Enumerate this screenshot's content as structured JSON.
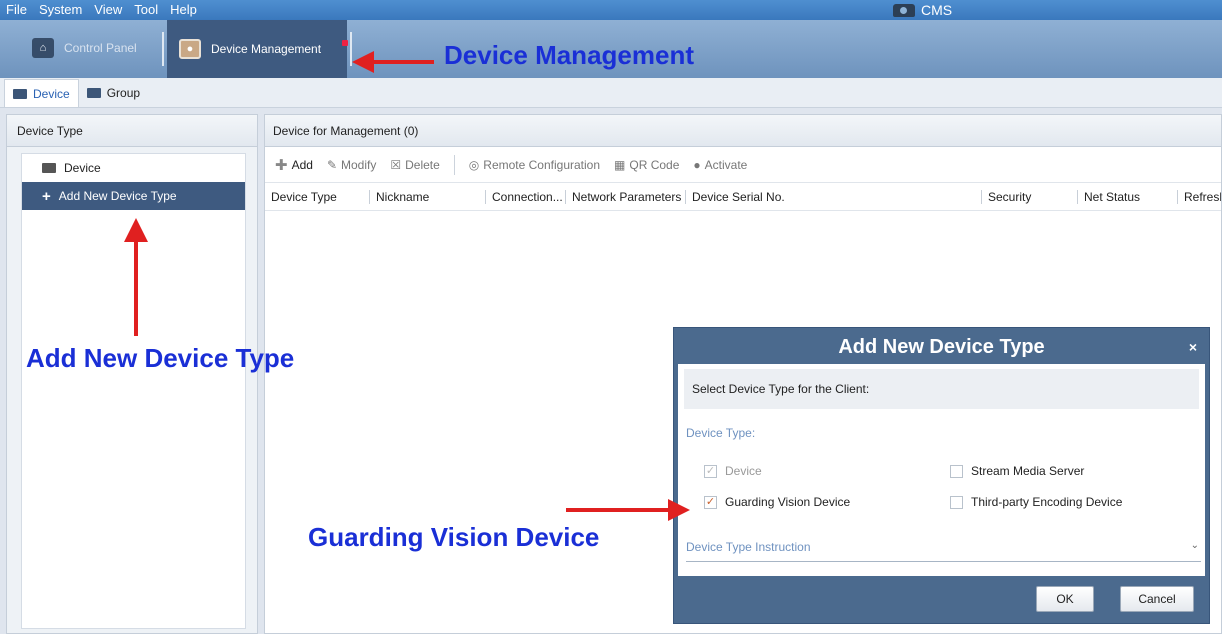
{
  "menubar": {
    "items": [
      "File",
      "System",
      "View",
      "Tool",
      "Help"
    ],
    "app_title": "CMS"
  },
  "module_tabs": {
    "control_panel": "Control Panel",
    "device_management": "Device Management"
  },
  "sub_tabs": {
    "device": "Device",
    "group": "Group"
  },
  "left_panel": {
    "title": "Device Type",
    "items": [
      "Device",
      "Add New Device Type"
    ]
  },
  "main_panel": {
    "title": "Device for Management (0)",
    "toolbar": {
      "add": "Add",
      "modify": "Modify",
      "delete": "Delete",
      "remote_config": "Remote Configuration",
      "qr_code": "QR Code",
      "activate": "Activate"
    },
    "columns": [
      "Device Type",
      "Nickname",
      "Connection...",
      "Network Parameters",
      "Device Serial No.",
      "Security",
      "Net Status",
      "Refresh"
    ]
  },
  "dialog": {
    "title": "Add New Device Type",
    "close": "×",
    "prompt": "Select Device Type for the Client:",
    "section_label": "Device Type:",
    "options": {
      "device": "Device",
      "stream_media_server": "Stream Media Server",
      "guarding_vision_device": "Guarding Vision Device",
      "third_party_encoding": "Third-party Encoding Device"
    },
    "instruction": "Device Type Instruction",
    "ok": "OK",
    "cancel": "Cancel"
  },
  "annotations": {
    "device_management": "Device Management",
    "add_new_device_type": "Add New Device Type",
    "guarding_vision_device": "Guarding Vision Device"
  },
  "colors": {
    "annotation_text": "#1a2fd6",
    "annotation_arrow": "#e02020",
    "selected_bg": "#3e5a80",
    "dialog_frame": "#4b6a8e"
  }
}
